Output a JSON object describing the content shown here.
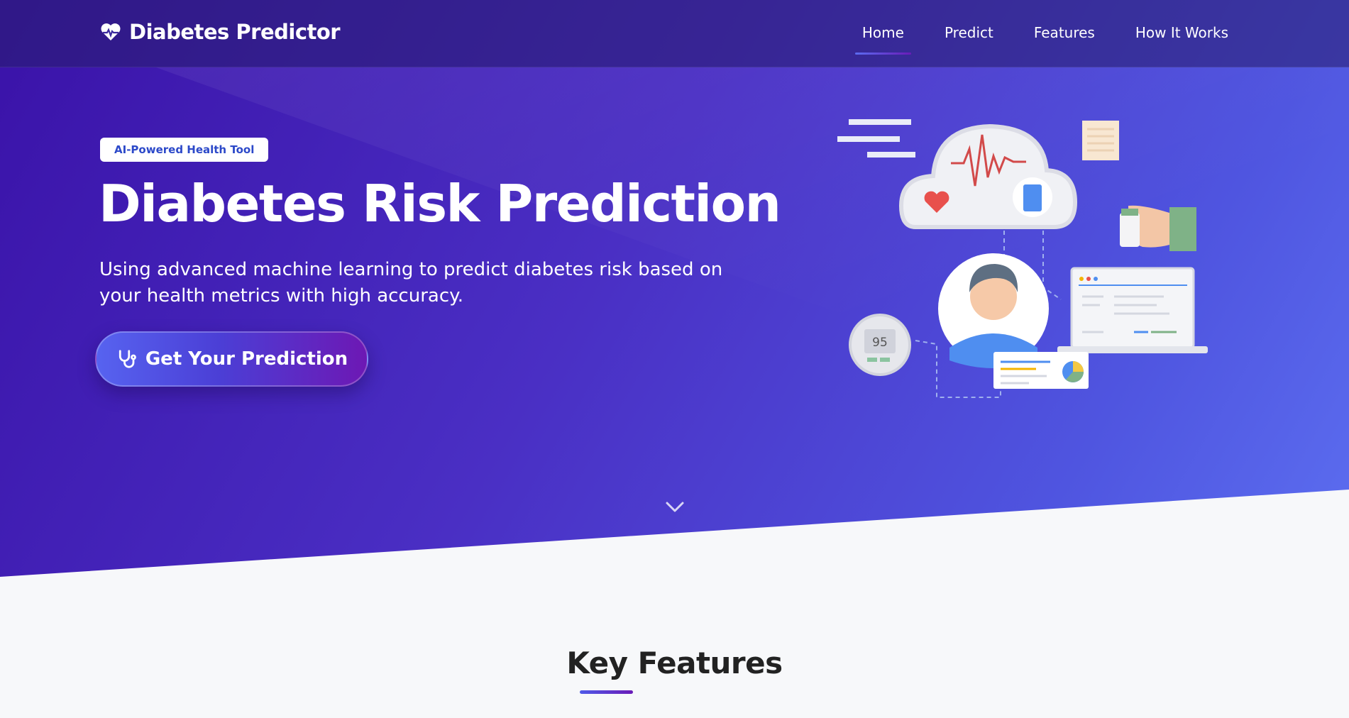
{
  "brand": {
    "name": "Diabetes Predictor",
    "icon": "heart-pulse-icon"
  },
  "nav": {
    "items": [
      {
        "label": "Home",
        "active": true
      },
      {
        "label": "Predict",
        "active": false
      },
      {
        "label": "Features",
        "active": false
      },
      {
        "label": "How It Works",
        "active": false
      }
    ]
  },
  "hero": {
    "badge": "AI-Powered Health Tool",
    "title": "Diabetes Risk Prediction",
    "subtitle": "Using advanced machine learning to predict diabetes risk based on your health metrics with high accuracy.",
    "cta_label": "Get Your Prediction",
    "cta_icon": "stethoscope-icon",
    "illustration": {
      "gauge_value": "95"
    }
  },
  "features": {
    "title": "Key Features"
  },
  "colors": {
    "hero_start": "#3a12a8",
    "hero_end": "#5c6ef0",
    "badge_text": "#2c49c9",
    "accent_purple": "#6a1bb8",
    "accent_blue": "#4f5ae8",
    "page_bg": "#f7f8fa"
  }
}
